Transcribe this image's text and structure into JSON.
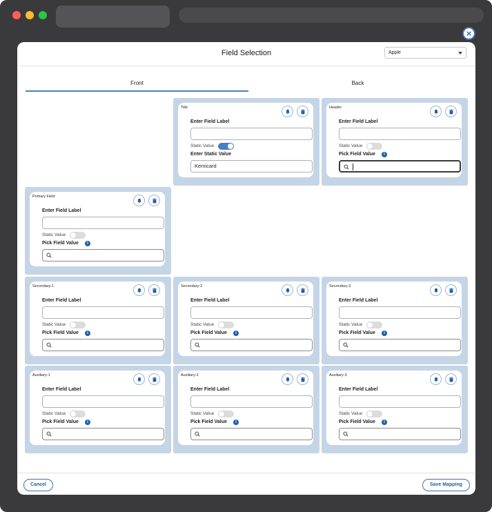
{
  "modal": {
    "title": "Field Selection",
    "close_label": "×",
    "brand_select": {
      "value": "Apple"
    },
    "tabs": [
      {
        "label": "Front"
      },
      {
        "label": "Back"
      }
    ],
    "field_label_text": "Enter Field Label",
    "static_value_text": "Static Value",
    "pick_field_value_text": "Pick Field Value",
    "enter_static_value_text": "Enter Static Value",
    "cards": {
      "title": {
        "name": "Title",
        "static_on": true,
        "static_value": "Kemicard"
      },
      "header": {
        "name": "Header",
        "static_on": false
      },
      "primary": {
        "name": "Primary Field",
        "static_on": false
      },
      "secondary1": {
        "name": "Secondary-1",
        "static_on": false
      },
      "secondary2": {
        "name": "Secondary-2",
        "static_on": false
      },
      "secondary3": {
        "name": "Secondary-3",
        "static_on": false
      },
      "auxiliary1": {
        "name": "Auxiliary-1",
        "static_on": false
      },
      "auxiliary2": {
        "name": "Auxiliary-2",
        "static_on": false
      },
      "auxiliary3": {
        "name": "Auxiliary-3",
        "static_on": false
      }
    },
    "footer": {
      "cancel_label": "Cancel",
      "save_label": "Save Mapping"
    }
  },
  "colors": {
    "accent": "#3d82c7",
    "panel": "#c5d5e6",
    "link": "#1f5fa8"
  },
  "icons": [
    "bell-icon",
    "trash-icon",
    "search-icon",
    "info-icon",
    "close-icon",
    "chevron-down-icon"
  ]
}
